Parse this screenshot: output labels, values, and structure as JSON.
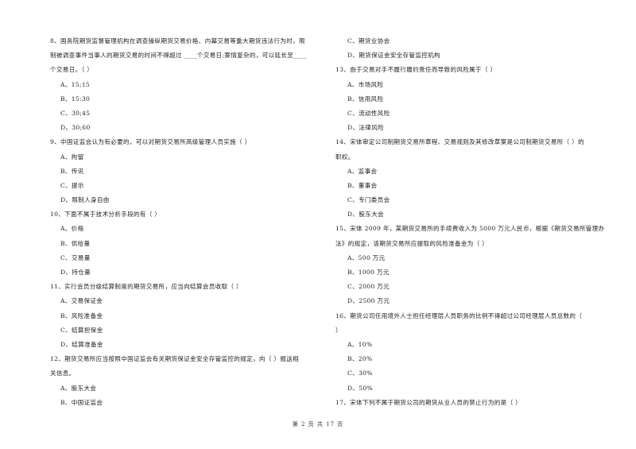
{
  "left_column": [
    {
      "type": "q",
      "text": "8、国务院期货监督管理机构在调查操纵期货交易价格、内幕交易等重大期货违法行为时，限"
    },
    {
      "type": "q",
      "text": "制被调查事件当事人的期货交易的时间不得超过 ____个交易日;案情复杂的，可以延长至____"
    },
    {
      "type": "q",
      "text": "个交易日。（    ）"
    },
    {
      "type": "opt",
      "text": "A、15;15"
    },
    {
      "type": "opt",
      "text": "B、15:30"
    },
    {
      "type": "opt",
      "text": "C、30;45"
    },
    {
      "type": "opt",
      "text": "D、30;60"
    },
    {
      "type": "q",
      "text": "9、中国证监会认为有必要的，可以对期货交易所高级管理人员实施（    ）"
    },
    {
      "type": "opt",
      "text": "A、拘留"
    },
    {
      "type": "opt",
      "text": "B、传讯"
    },
    {
      "type": "opt",
      "text": "C、提示"
    },
    {
      "type": "opt",
      "text": "D、限制人身自由"
    },
    {
      "type": "q",
      "text": "10、下面不属于技术分析手段的有（    ）"
    },
    {
      "type": "opt",
      "text": "A、价格"
    },
    {
      "type": "opt",
      "text": "B、供给量"
    },
    {
      "type": "opt",
      "text": "C、交易量"
    },
    {
      "type": "opt",
      "text": "D、持仓量"
    },
    {
      "type": "q",
      "text": "11、实行会员分级结算制度的期货交易所，应当向结算会员收取（    ）"
    },
    {
      "type": "opt",
      "text": "A、交易保证金"
    },
    {
      "type": "opt",
      "text": "B、风险准备金"
    },
    {
      "type": "opt",
      "text": "C、结算担保金"
    },
    {
      "type": "opt",
      "text": "D、结算准备金"
    },
    {
      "type": "q",
      "text": "12、期货交易所应当按照中国证监会有关期货保证金安全存管监控的规定，向（    ）报送相"
    },
    {
      "type": "q",
      "text": "关信息。"
    },
    {
      "type": "opt",
      "text": "A、股东大会"
    },
    {
      "type": "opt",
      "text": "B、中国证监会"
    }
  ],
  "right_column": [
    {
      "type": "opt",
      "text": "C、期货业协会"
    },
    {
      "type": "opt",
      "text": "D、期货保证金安全存管监控机构"
    },
    {
      "type": "q",
      "text": "13、由于交易对手不履行履约责任而导致的风险属于（    ）"
    },
    {
      "type": "opt",
      "text": "A、市场风险"
    },
    {
      "type": "opt",
      "text": "B、信用风险"
    },
    {
      "type": "opt",
      "text": "C、流动性风险"
    },
    {
      "type": "opt",
      "text": "D、法律风险"
    },
    {
      "type": "q",
      "text": "14、宋体审定公司制期货交易所章程、交易规则及其修改草案是公司制期货交易所（    ）的"
    },
    {
      "type": "q",
      "text": "职权。"
    },
    {
      "type": "opt",
      "text": "A、监事会"
    },
    {
      "type": "opt",
      "text": "B、董事会"
    },
    {
      "type": "opt",
      "text": "C、专门委员会"
    },
    {
      "type": "opt",
      "text": "D、股东大会"
    },
    {
      "type": "q",
      "text": "15、宋体 2009 年，某期货交易所的手续费收入为 5000 万元人民币，根据《期货交易所管理办"
    },
    {
      "type": "q",
      "text": "法》的规定，该期货交易所应提取的风险准备金为（    ）"
    },
    {
      "type": "opt",
      "text": "A、500 万元"
    },
    {
      "type": "opt",
      "text": "B、1000 万元"
    },
    {
      "type": "opt",
      "text": "C、2000 万元"
    },
    {
      "type": "opt",
      "text": "D、2500 万元"
    },
    {
      "type": "q",
      "text": "16、期货公司任用境外人士担任经理层人员职务的比例不得超过公司经理层人员总数的（"
    },
    {
      "type": "q",
      "text": "）"
    },
    {
      "type": "opt",
      "text": "A、10%"
    },
    {
      "type": "opt",
      "text": "B、20%"
    },
    {
      "type": "opt",
      "text": "C、30%"
    },
    {
      "type": "opt",
      "text": "D、50%"
    },
    {
      "type": "q",
      "text": "17、宋体下列不属于期货公司的期货从业人员的禁止行为的是（    ）"
    }
  ],
  "footer": {
    "page_label": "第 2 页 共 17 页"
  }
}
